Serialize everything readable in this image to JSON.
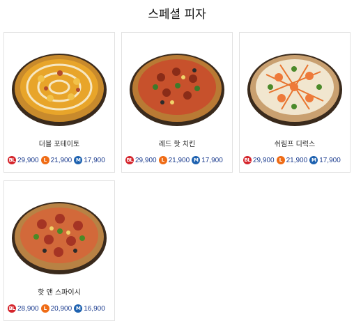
{
  "page": {
    "title": "스페셜 피자"
  },
  "colors": {
    "bl_badge": "#d5252c",
    "l_badge": "#ef6c16",
    "m_badge": "#1e62b0",
    "price_text": "#1d3d8f"
  },
  "size_labels": {
    "bl": "BL",
    "l": "L",
    "m": "M"
  },
  "products": [
    {
      "name": "더블 포테이토",
      "image": "pizza-double-potato",
      "prices": {
        "bl": "29,900",
        "l": "21,900",
        "m": "17,900"
      }
    },
    {
      "name": "레드 핫 치킨",
      "image": "pizza-red-hot-chicken",
      "prices": {
        "bl": "29,900",
        "l": "21,900",
        "m": "17,900"
      }
    },
    {
      "name": "쉬림프 디럭스",
      "image": "pizza-shrimp-deluxe",
      "prices": {
        "bl": "29,900",
        "l": "21,900",
        "m": "17,900"
      }
    },
    {
      "name": "핫 앤 스파이시",
      "image": "pizza-hot-and-spicy",
      "prices": {
        "bl": "28,900",
        "l": "20,900",
        "m": "16,900"
      }
    }
  ]
}
